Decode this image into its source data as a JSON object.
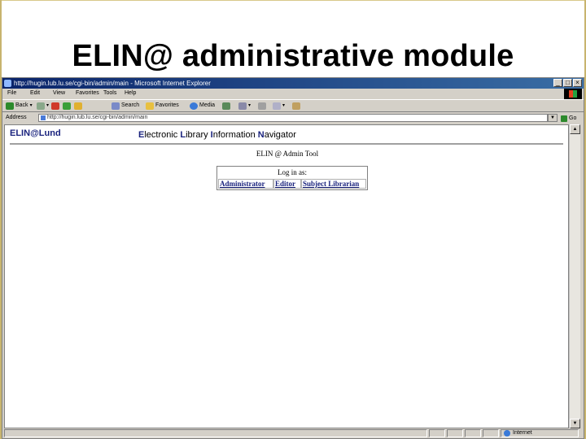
{
  "slide": {
    "title": "ELIN@ administrative module"
  },
  "window": {
    "title": "http://hugin.lub.lu.se/cgi-bin/admin/main - Microsoft Internet Explorer",
    "buttons": [
      "_",
      "□",
      "×"
    ]
  },
  "menubar": {
    "items": [
      "File",
      "Edit",
      "View",
      "Favorites",
      "Tools",
      "Help"
    ]
  },
  "toolbar": {
    "back": "Back",
    "search": "Search",
    "favorites": "Favorites",
    "media": "Media"
  },
  "address": {
    "label": "Address",
    "value": "http://hugin.lub.lu.se/cgi-bin/admin/main",
    "go": "Go"
  },
  "page": {
    "logo_prefix": "ELIN",
    "logo_at": "@",
    "logo_suffix": "Lund",
    "nav_title": "Electronic Library Information Navigator",
    "admin_title": "ELIN @ Admin Tool",
    "login_label": "Log in as:",
    "roles": [
      "Administrator",
      "Editor",
      "Subject Librarian"
    ]
  },
  "status": {
    "zone": "Internet"
  },
  "colors": {
    "link": "#1a237e",
    "titlebar": "#0a246a",
    "chrome": "#d4d0c8"
  }
}
